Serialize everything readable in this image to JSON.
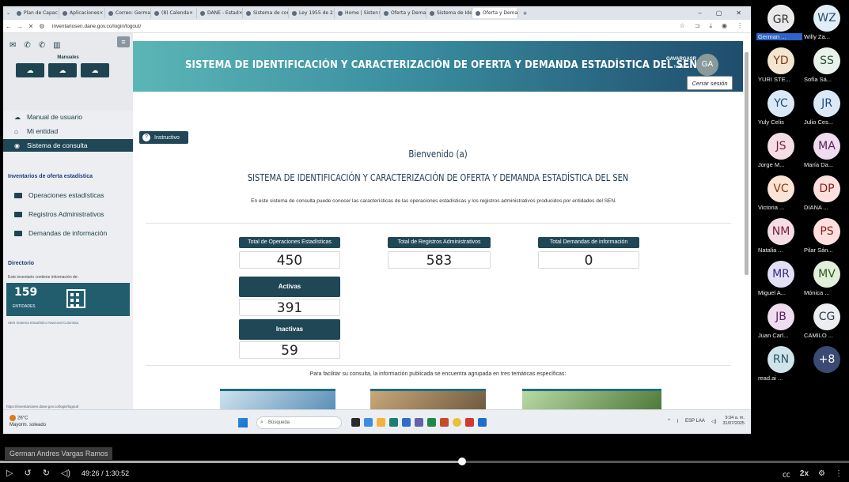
{
  "browser": {
    "tabs": [
      {
        "label": "Plan de Capac"
      },
      {
        "label": "Aplicaciones"
      },
      {
        "label": "Correo: Germa"
      },
      {
        "label": "(8) Calenda"
      },
      {
        "label": "DANE - Estad"
      },
      {
        "label": "Sistema de con"
      },
      {
        "label": "Ley 1955 de 2"
      },
      {
        "label": "Home | Sisten"
      },
      {
        "label": "Oferta y Dema"
      },
      {
        "label": "Sistema de Ide"
      },
      {
        "label": "Oferta y Dema"
      }
    ],
    "url": "inventariosen.dane.gov.co/login/logout/"
  },
  "sidebar": {
    "manuales_label": "Manuales",
    "items": [
      {
        "label": "Manual de usuario",
        "icon": "cloud-icon"
      },
      {
        "label": "Mi entidad",
        "icon": "home-icon"
      },
      {
        "label": "Sistema de consulta",
        "icon": "eye-icon"
      }
    ],
    "inventarios_title": "Inventarios de oferta estadística",
    "inventarios": [
      {
        "label": "Operaciones estadísticas"
      },
      {
        "label": "Registros Administrativos"
      },
      {
        "label": "Demandas de información"
      }
    ],
    "directorio_title": "Directorio",
    "directorio_desc": "Este inventario contiene información de:",
    "entidades_count": "159",
    "entidades_label": "ENTIDADES",
    "footer": "SEN Sistema Estadístico Nacional Colombia",
    "status_url": "https://inventariosen.dane.gov.co/login/logout/"
  },
  "header": {
    "title": "SISTEMA DE IDENTIFICACIÓN Y CARACTERIZACIÓN DE OFERTA Y DEMANDA ESTADÍSTICA DEL SEN",
    "user": "GAVARGASR",
    "role": "Tematico",
    "avatar": "GA",
    "logout_tooltip": "Cerrar sesión"
  },
  "main": {
    "instructivo": "Instructivo",
    "welcome": "Bienvenido (a)",
    "subtitle": "SISTEMA DE IDENTIFICACIÓN Y CARACTERIZACIÓN DE OFERTA Y DEMANDA ESTADÍSTICA DEL SEN",
    "intro": "En este sistema de consulta puede conocer las características de las operaciones estadísticas y los registros administrativos producidos por entidades del SEN.",
    "stats": {
      "operaciones": {
        "label": "Total de Operaciones Estadísticas",
        "value": "450"
      },
      "registros": {
        "label": "Total de Registros Administrativos",
        "value": "583"
      },
      "demandas": {
        "label": "Total Demandas de información",
        "value": "0"
      },
      "activas": {
        "label": "Activas",
        "value": "391"
      },
      "inactivas": {
        "label": "Inactivas",
        "value": "59"
      }
    },
    "topics_intro": "Para facilitar su consulta, la información publicada se encuentra agrupada en tres temáticas específicas:"
  },
  "taskbar": {
    "weather_temp": "26°C",
    "weather_desc": "Mayorm. soleado",
    "search": "Búsqueda",
    "lang": "ESP LAA",
    "time": "9:34 a. m.",
    "date": "31/07/2025"
  },
  "participants": [
    {
      "initials": "GR",
      "name": "German ...",
      "bg": "#e9e9e9",
      "fg": "#333333",
      "highlight": true
    },
    {
      "initials": "WZ",
      "name": "Willy Za...",
      "bg": "#e0eef7",
      "fg": "#2b4a6a"
    },
    {
      "initials": "YD",
      "name": "YURI STE...",
      "bg": "#f3e6d0",
      "fg": "#7a3a10"
    },
    {
      "initials": "SS",
      "name": "Sofía Sá...",
      "bg": "#e9f2ea",
      "fg": "#2a4a33"
    },
    {
      "initials": "YC",
      "name": "Yuly Celis",
      "bg": "#dbe9f7",
      "fg": "#234a78"
    },
    {
      "initials": "JR",
      "name": "Julio Ces...",
      "bg": "#dbe9f7",
      "fg": "#234a78"
    },
    {
      "initials": "JS",
      "name": "Jorge M...",
      "bg": "#f5dde6",
      "fg": "#7a2040"
    },
    {
      "initials": "MA",
      "name": "María Da...",
      "bg": "#efdcef",
      "fg": "#5a2060"
    },
    {
      "initials": "VC",
      "name": "Victoria ...",
      "bg": "#fbe4d3",
      "fg": "#8a3a10"
    },
    {
      "initials": "DP",
      "name": "DIANA ...",
      "bg": "#fde0de",
      "fg": "#8a1d18"
    },
    {
      "initials": "NM",
      "name": "Natalia ...",
      "bg": "#f5dde6",
      "fg": "#7a2040"
    },
    {
      "initials": "PS",
      "name": "Pilar Sán...",
      "bg": "#fde0de",
      "fg": "#8a1d18"
    },
    {
      "initials": "MR",
      "name": "Miguel A...",
      "bg": "#e2e0f5",
      "fg": "#3a2a7a"
    },
    {
      "initials": "MV",
      "name": "Mónica ...",
      "bg": "#e2f0d9",
      "fg": "#2e5a1a"
    },
    {
      "initials": "JB",
      "name": "Juan Carl...",
      "bg": "#efdcef",
      "fg": "#5a2060"
    },
    {
      "initials": "CG",
      "name": "CAMILO ...",
      "bg": "#eceef2",
      "fg": "#333a48"
    },
    {
      "initials": "RN",
      "name": "read.ai ...",
      "bg": "#cfe3ea",
      "fg": "#2a5563"
    },
    {
      "initials": "+8",
      "name": "",
      "bg": "#3b4a73",
      "fg": "#ffffff"
    }
  ],
  "meeting": {
    "speaker": "German Andres Vargas Ramos",
    "time_current": "49:26",
    "time_total": "1:30:52",
    "progress": 0.544,
    "speed": "2x"
  }
}
